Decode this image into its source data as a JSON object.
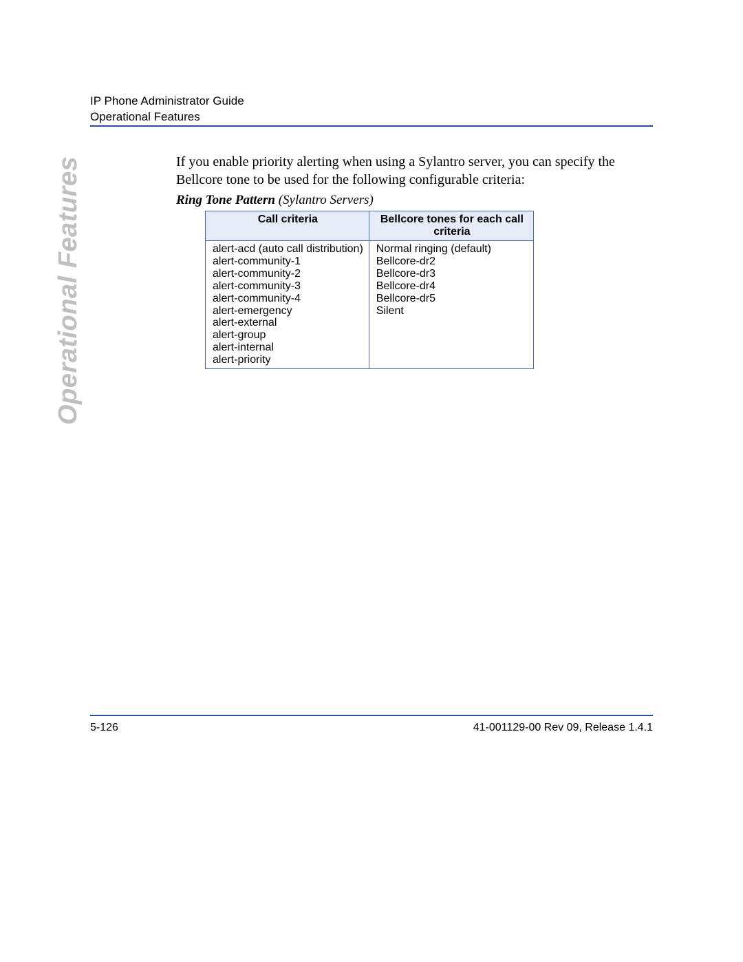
{
  "header": {
    "line1": "IP Phone Administrator Guide",
    "line2": "Operational Features"
  },
  "body_paragraph": "If you enable priority alerting when using a Sylantro server, you can specify the Bellcore tone to be used for the following configurable criteria:",
  "subheading": {
    "bold": "Ring Tone Pattern",
    "italic": " (Sylantro Servers)"
  },
  "table": {
    "headers": [
      "Call criteria",
      "Bellcore tones for each call criteria"
    ],
    "col1": [
      "alert-acd (auto call distribution)",
      "alert-community-1",
      "alert-community-2",
      "alert-community-3",
      "alert-community-4",
      "alert-emergency",
      "alert-external",
      "alert-group",
      "alert-internal",
      "alert-priority"
    ],
    "col2": [
      "Normal ringing (default)",
      "Bellcore-dr2",
      "Bellcore-dr3",
      "Bellcore-dr4",
      "Bellcore-dr5",
      "Silent"
    ]
  },
  "side_tab": "Operational Features",
  "footer": {
    "left": "5-126",
    "right": "41-001129-00 Rev 09, Release 1.4.1"
  }
}
